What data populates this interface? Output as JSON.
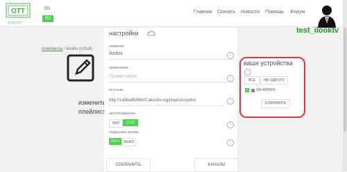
{
  "header": {
    "logo_text": "OTT",
    "logo_caption": "player",
    "lang_en": "EN",
    "lang_ru": "RU",
    "nav": [
      "Главная",
      "Скачать",
      "Новости",
      "Помощь",
      "Форум"
    ],
    "username": "test_ilooktv"
  },
  "breadcrumb": {
    "link": "плейлисты",
    "sep": "/",
    "current": "ilooktv (m3u8)"
  },
  "edit_label": "изменить плейлист",
  "settings": {
    "title": "настройки",
    "name_label": "название",
    "name_value": "ilooktv",
    "note_label": "примечание",
    "note_placeholder": "Примечание",
    "source_label": "источник",
    "source_value": "http://1a58a95868d7.akciatv.org/playlists/uplist/",
    "autoupdate_label": "автообновление",
    "autoupdate_on": "ВКЛ",
    "autoupdate_value": "12:22",
    "archive_label": "поддержка архива",
    "archive_value": "1%?1",
    "archive_off": "ВЫКЛ",
    "save": "СОХРАНИТЬ",
    "channels": "КАНАЛЫ"
  },
  "devices": {
    "title": "ваши устройства",
    "all": "ВСЕ",
    "none": "НИ ОДНОГО",
    "device_name": "SM-A505FN",
    "save": "СОХРАНИТЬ"
  },
  "colors": {
    "accent": "#4ed24e",
    "highlight": "#e63232"
  }
}
